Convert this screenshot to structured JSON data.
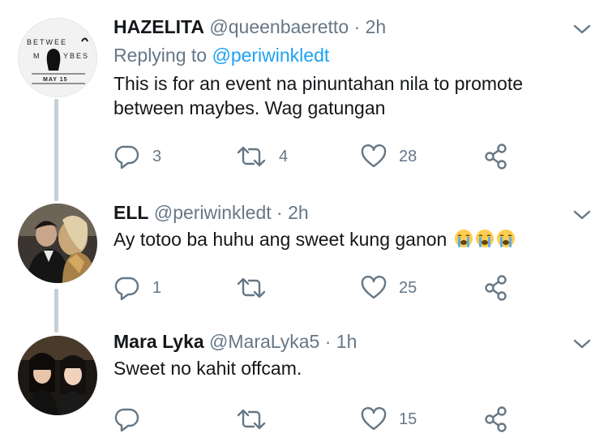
{
  "tweets": [
    {
      "name": "HAZELITA",
      "handle": "@queenbaeretto",
      "separator": "·",
      "time": "2h",
      "replying_prefix": "Replying to ",
      "replying_to": "@periwinkledt",
      "body_line1": "This is for an event na pinuntahan nila  to promote",
      "body_line2": "between maybes. Wag gatungan",
      "reply_count": "3",
      "retweet_count": "4",
      "like_count": "28",
      "avatar_logo": {
        "line1": "BETWEE",
        "line2_left": "M",
        "line2_right": "YBES",
        "date": "MAY 15"
      }
    },
    {
      "name": "ELL",
      "handle": "@periwinkledt",
      "separator": "·",
      "time": "2h",
      "body_line1": "Ay totoo ba huhu ang sweet kung ganon",
      "reply_count": "1",
      "retweet_count": "",
      "like_count": "25"
    },
    {
      "name": "Mara Lyka",
      "handle": "@MaraLyka5",
      "separator": "·",
      "time": "1h",
      "body_line1": "Sweet no kahit offcam.",
      "reply_count": "",
      "retweet_count": "",
      "like_count": "15"
    }
  ],
  "colors": {
    "secondary": "#657786",
    "link": "#1da1f2",
    "thread": "#c4cfd6",
    "text": "#14171a"
  },
  "icons": [
    "reply-icon",
    "retweet-icon",
    "like-icon",
    "share-icon",
    "chevron-down-icon",
    "loudly-crying-face-emoji"
  ]
}
